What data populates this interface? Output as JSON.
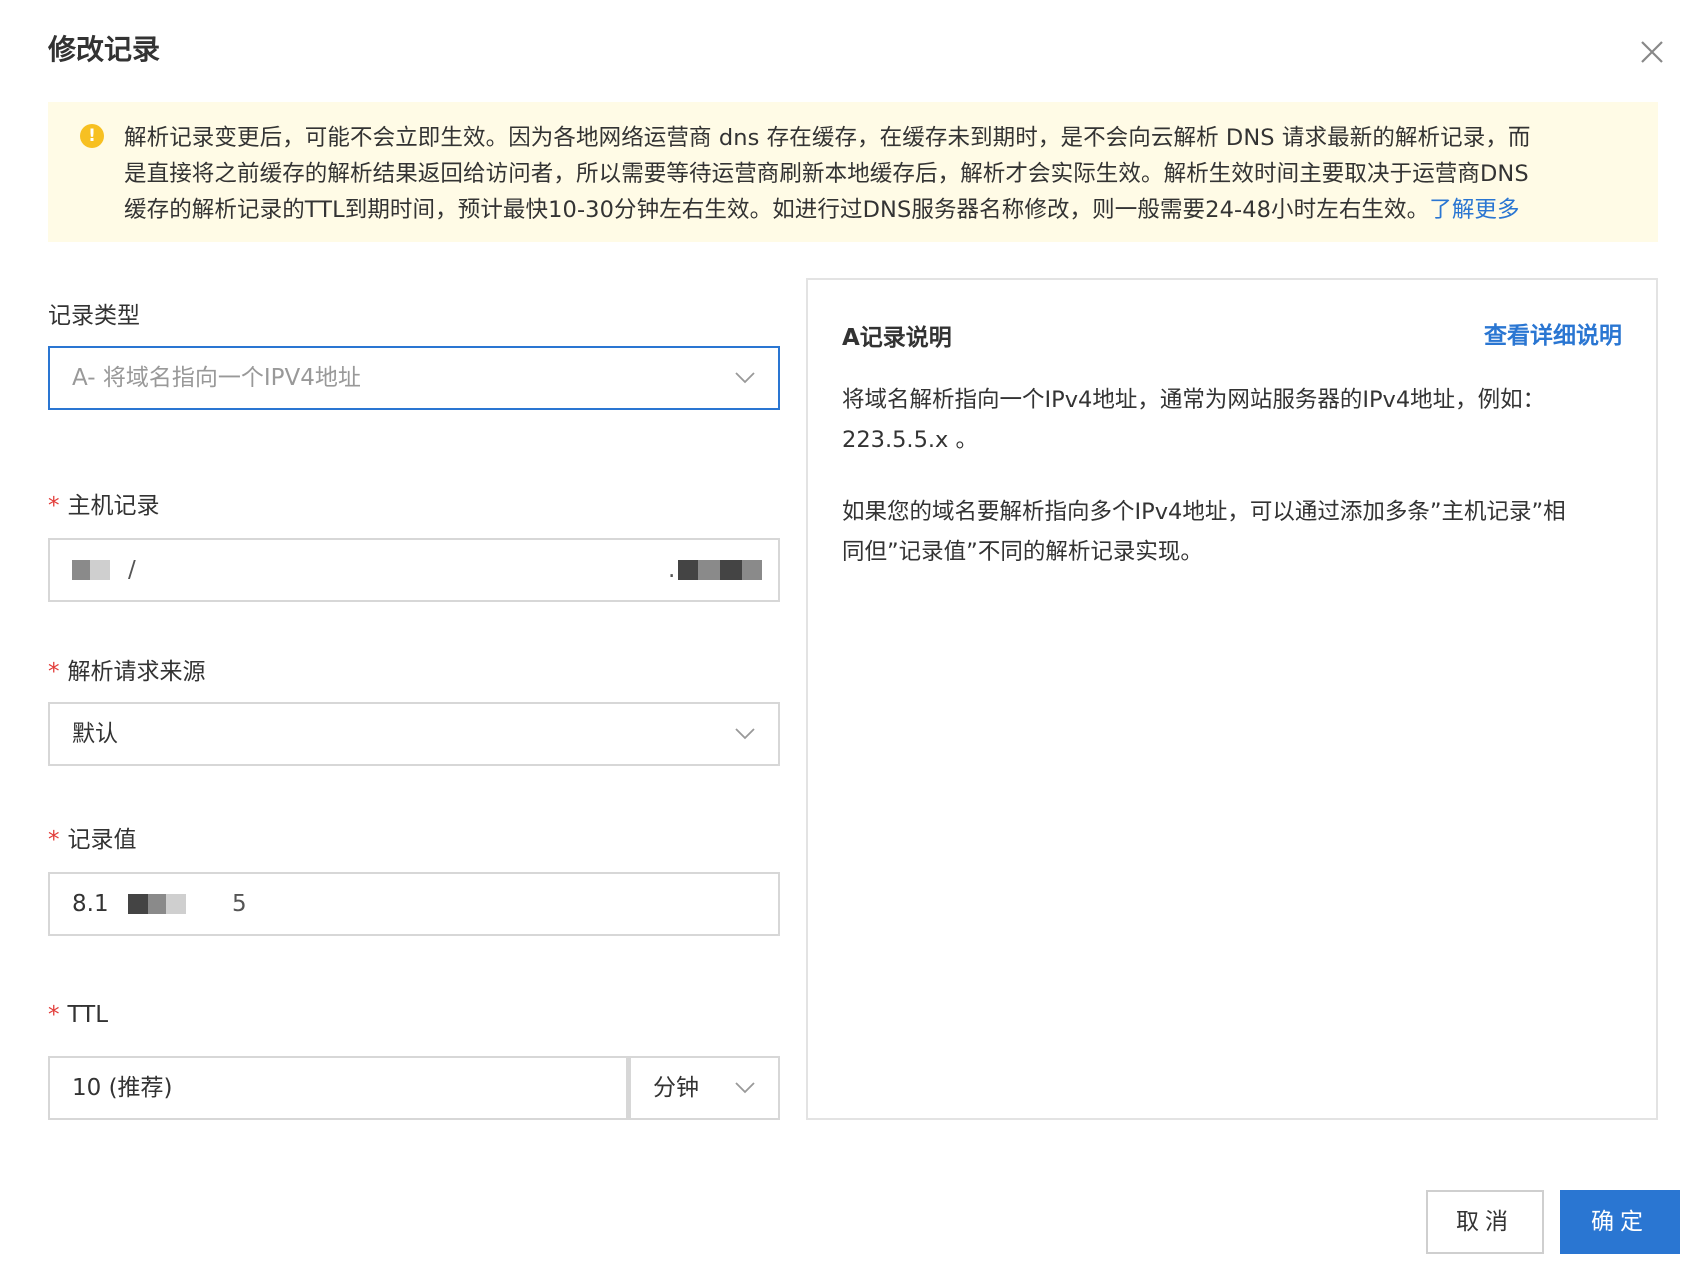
{
  "dialog": {
    "title": "修改记录"
  },
  "notice": {
    "line1": "解析记录变更后，可能不会立即生效。因为各地网络运营商 dns 存在缓存，在缓存未到期时，是不会向云解析 DNS 请求最新的解析记录，而",
    "line2": "是直接将之前缓存的解析结果返回给访问者，所以需要等待运营商刷新本地缓存后，解析才会实际生效。解析生效时间主要取决于运营商DNS",
    "line3": "缓存的解析记录的TTL到期时间，预计最快10-30分钟左右生效。如进行过DNS服务器名称修改，则一般需要24-48小时左右生效。",
    "link": "了解更多"
  },
  "form": {
    "record_type": {
      "label": "记录类型",
      "value": "A- 将域名指向一个IPV4地址"
    },
    "host": {
      "required_mark": "*",
      "label": "主机记录",
      "value_prefix": "/",
      "value_suffix": "."
    },
    "source": {
      "required_mark": "*",
      "label": "解析请求来源",
      "value": "默认"
    },
    "record_value": {
      "required_mark": "*",
      "label": "记录值",
      "value_prefix": "8.1",
      "value_suffix": "5"
    },
    "ttl": {
      "required_mark": "*",
      "label": "TTL",
      "value": "10 (推荐)",
      "unit": "分钟"
    }
  },
  "description": {
    "title": "A记录说明",
    "link": "查看详细说明",
    "p1_line1": "将域名解析指向一个IPv4地址，通常为网站服务器的IPv4地址，例如：",
    "p1_line2": "223.5.5.x 。",
    "p2_line1": "如果您的域名要解析指向多个IPv4地址，可以通过添加多条”主机记录”相",
    "p2_line2": "同但”记录值”不同的解析记录实现。"
  },
  "buttons": {
    "cancel": "取消",
    "ok": "确定"
  },
  "colors": {
    "accent": "#2a76d2",
    "warning_bg": "#fffbe6",
    "warning_icon": "#f7c022",
    "required": "#e23c39"
  },
  "icons": {
    "close": "close-icon",
    "warning": "warning-circle-icon",
    "dropdown": "chevron-down-icon"
  }
}
